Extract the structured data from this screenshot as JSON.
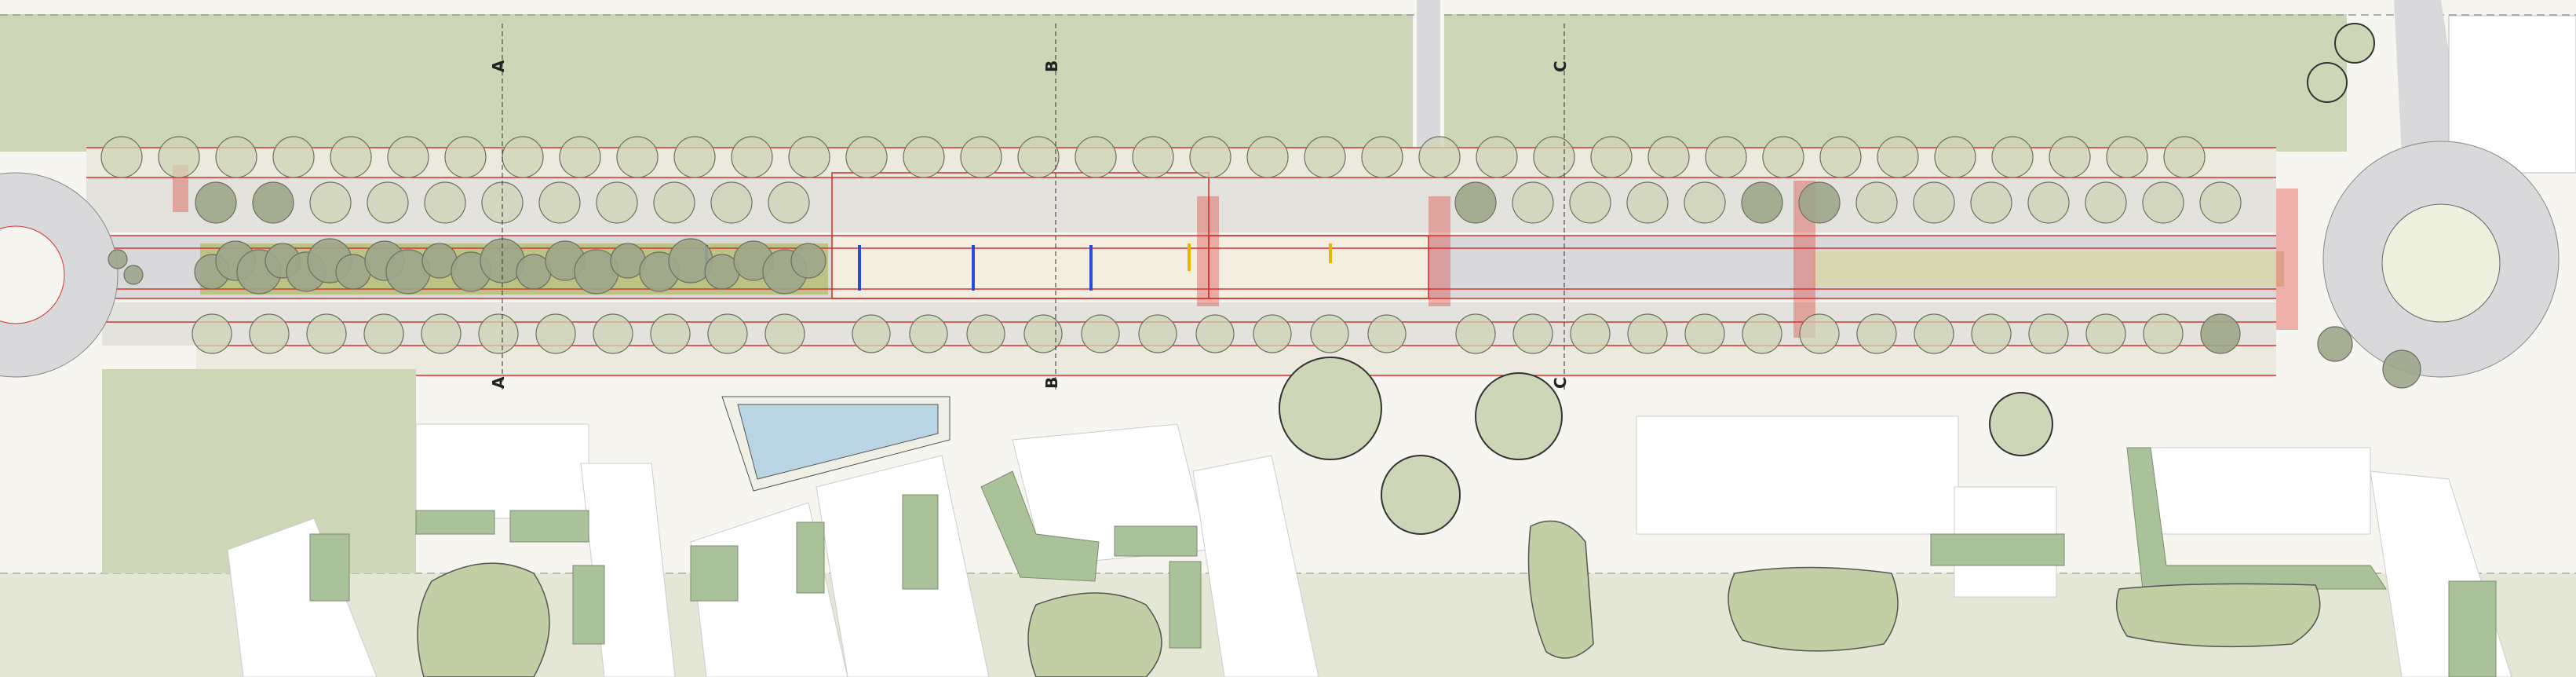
{
  "sections": [
    {
      "id": "A",
      "label_top": "A",
      "label_bottom": "A"
    },
    {
      "id": "B",
      "label_top": "B",
      "label_bottom": "B"
    },
    {
      "id": "C",
      "label_top": "C",
      "label_bottom": "C"
    }
  ],
  "colors": {
    "background": "#f7f5ef",
    "grass": "#cdd7b8",
    "planting": "#b7bf73",
    "road": "#d9d9dc",
    "tree_stroke": "#7d7d6a",
    "curb_red": "#d9322f",
    "green_roof": "#a9c29a",
    "water": "#b9d4e2",
    "building": "#ffffff"
  },
  "icons": [
    "tree-symbol",
    "section-marker",
    "bus-stop-marker",
    "roundabout"
  ]
}
